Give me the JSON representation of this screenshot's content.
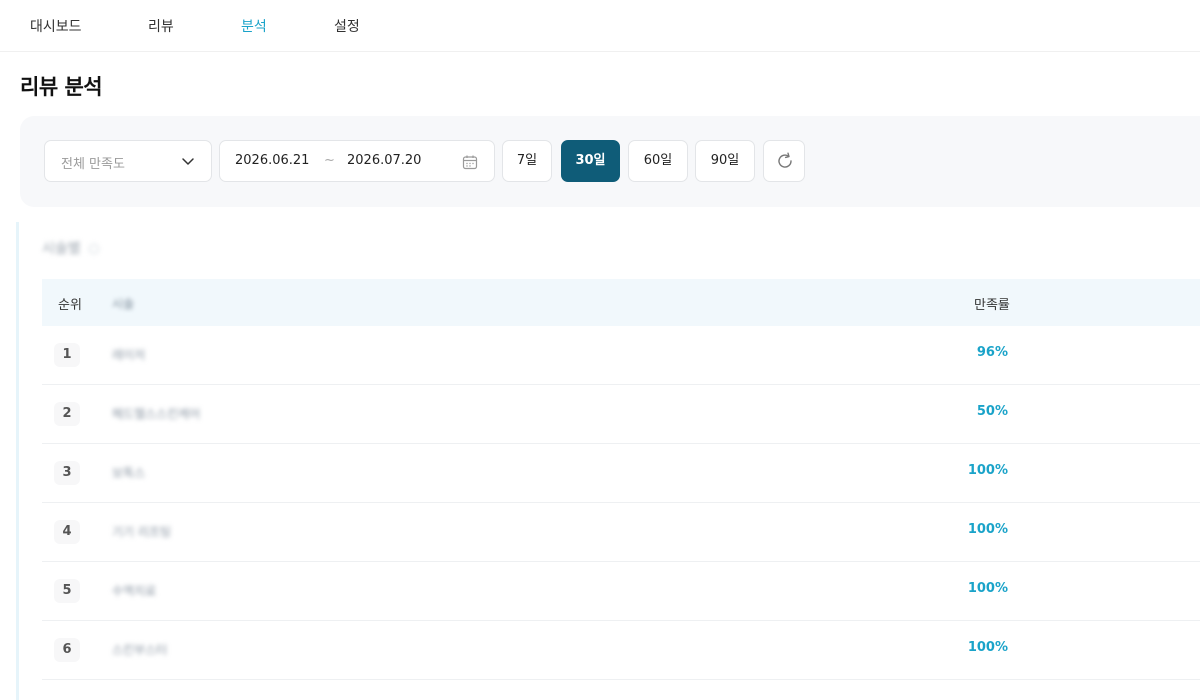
{
  "nav": {
    "items": [
      {
        "label": "대시보드",
        "active": false
      },
      {
        "label": "리뷰",
        "active": false
      },
      {
        "label": "분석",
        "active": true
      },
      {
        "label": "설정",
        "active": false
      }
    ]
  },
  "page": {
    "title": "리뷰 분석"
  },
  "filters": {
    "satisfaction_placeholder": "전체 만족도",
    "date_start": "2026.06.21",
    "date_separator": "~",
    "date_end": "2026.07.20",
    "periods": [
      {
        "label": "7일",
        "active": false
      },
      {
        "label": "30일",
        "active": true
      },
      {
        "label": "60일",
        "active": false
      },
      {
        "label": "90일",
        "active": false
      }
    ]
  },
  "section": {
    "title": "시술별"
  },
  "table": {
    "headers": {
      "rank": "순위",
      "name": "시술",
      "rate": "만족률"
    },
    "rows": [
      {
        "rank": "1",
        "name": "레이저",
        "rate": "96%"
      },
      {
        "rank": "2",
        "name": "헤드헬스스킨케어",
        "rate": "50%"
      },
      {
        "rank": "3",
        "name": "보톡스",
        "rate": "100%"
      },
      {
        "rank": "4",
        "name": "기기 리프팅",
        "rate": "100%"
      },
      {
        "rank": "5",
        "name": "수액치료",
        "rate": "100%"
      },
      {
        "rank": "6",
        "name": "스킨부스터",
        "rate": "100%"
      }
    ]
  },
  "colors": {
    "accent": "#1aa3c9",
    "active_button": "#0f5c78",
    "panel_bg": "#f7f8fa",
    "table_header_bg": "#f1f8fc"
  }
}
